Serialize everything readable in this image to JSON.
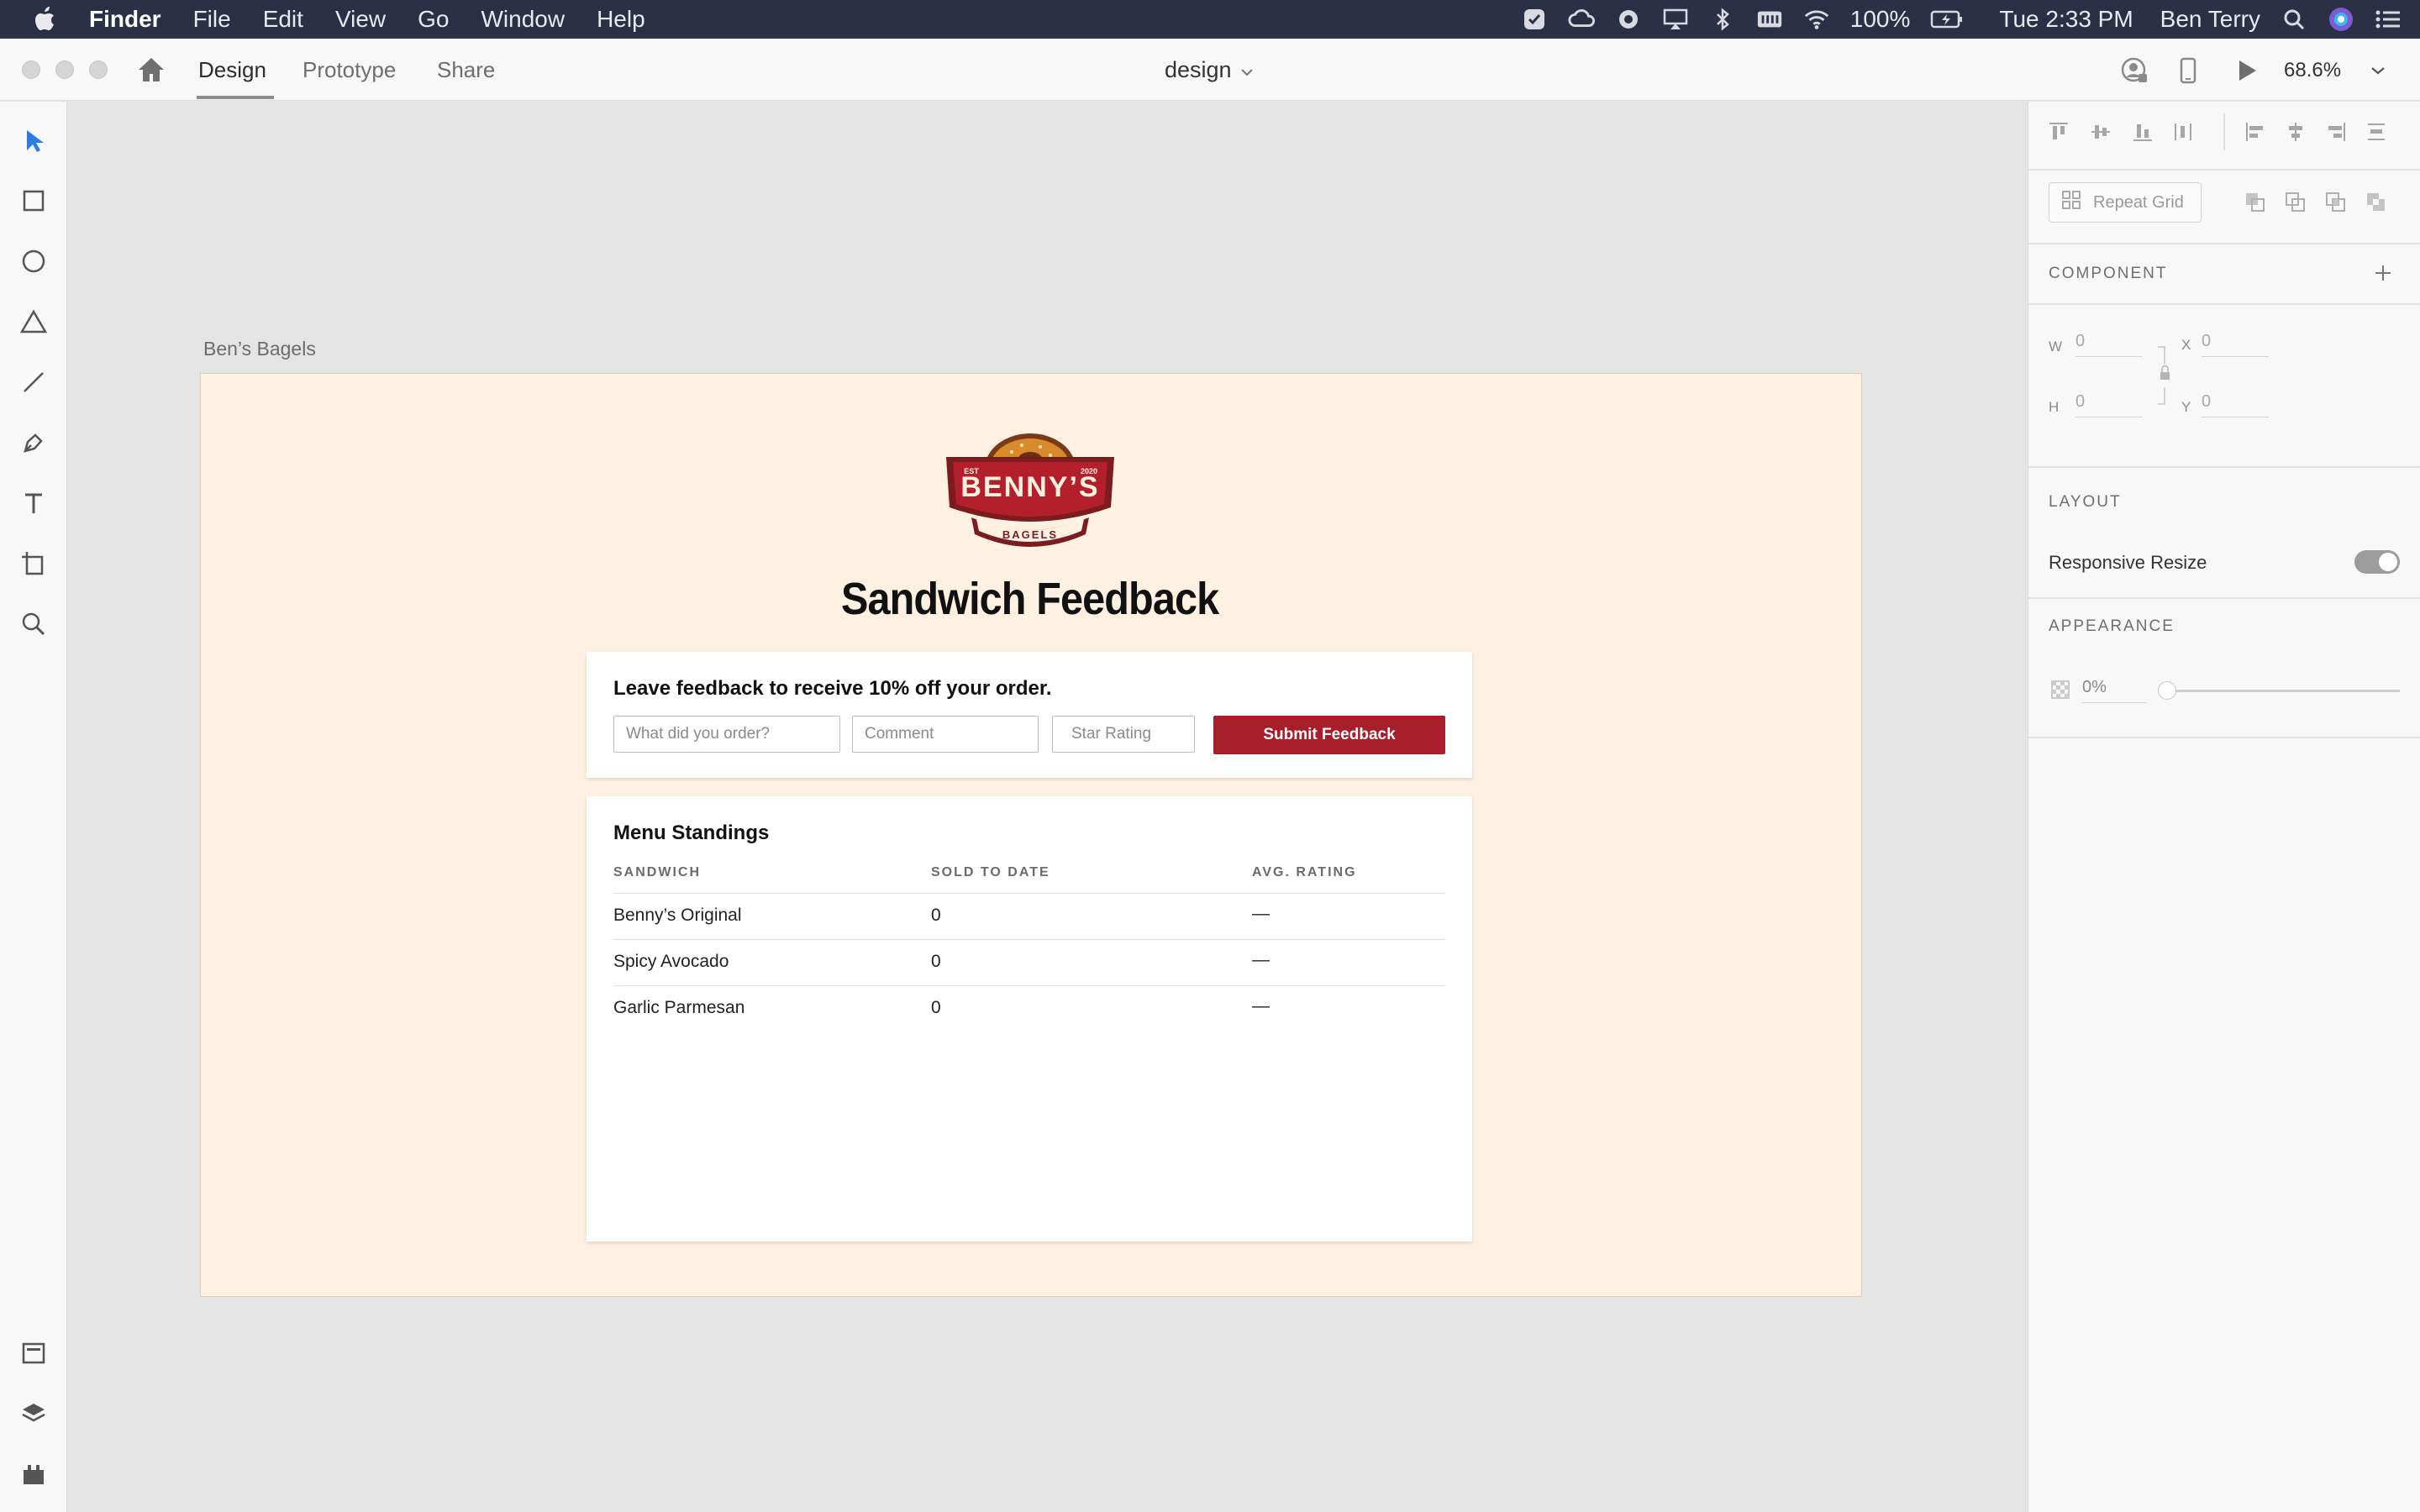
{
  "menubar": {
    "app_name": "Finder",
    "menus": [
      "File",
      "Edit",
      "View",
      "Go",
      "Window",
      "Help"
    ],
    "battery": "100%",
    "clock": "Tue 2:33 PM",
    "user": "Ben Terry"
  },
  "titlebar": {
    "tabs": [
      "Design",
      "Prototype",
      "Share"
    ],
    "active_tab": "Design",
    "document_title": "design",
    "zoom": "68.6%"
  },
  "left_tools": [
    "select-arrow-icon",
    "rectangle-icon",
    "ellipse-icon",
    "polygon-icon",
    "line-icon",
    "pen-icon",
    "text-icon",
    "artboard-icon",
    "zoom-icon",
    "assets-icon",
    "layers-icon",
    "plugins-icon"
  ],
  "artboard": {
    "label": "Ben’s Bagels",
    "background": "#fff1e1",
    "logo": {
      "main_text": "BENNY’S",
      "sub_text": "BAGELS",
      "est_left": "EST",
      "est_right": "2020",
      "color": "#b3202c"
    },
    "title": "Sandwich Feedback",
    "feedback_card": {
      "heading": "Leave feedback to receive 10% off your order.",
      "order_placeholder": "What did you order?",
      "comment_placeholder": "Comment",
      "rating_placeholder": "Star Rating",
      "submit_label": "Submit Feedback",
      "submit_color": "#a81d2a"
    },
    "standings_card": {
      "heading": "Menu Standings",
      "columns": [
        "SANDWICH",
        "SOLD TO DATE",
        "AVG. RATING"
      ],
      "rows": [
        {
          "sandwich": "Benny’s Original",
          "sold": "0",
          "rating": "—"
        },
        {
          "sandwich": "Spicy Avocado",
          "sold": "0",
          "rating": "—"
        },
        {
          "sandwich": "Garlic Parmesan",
          "sold": "0",
          "rating": "—"
        }
      ]
    }
  },
  "right_panel": {
    "repeat_grid_label": "Repeat Grid",
    "component_label": "COMPONENT",
    "w_label": "W",
    "w_value": "0",
    "h_label": "H",
    "h_value": "0",
    "x_label": "X",
    "x_value": "0",
    "y_label": "Y",
    "y_value": "0",
    "layout_label": "LAYOUT",
    "responsive_resize_label": "Responsive Resize",
    "responsive_resize_on": true,
    "appearance_label": "APPEARANCE",
    "opacity_value": "0%"
  }
}
